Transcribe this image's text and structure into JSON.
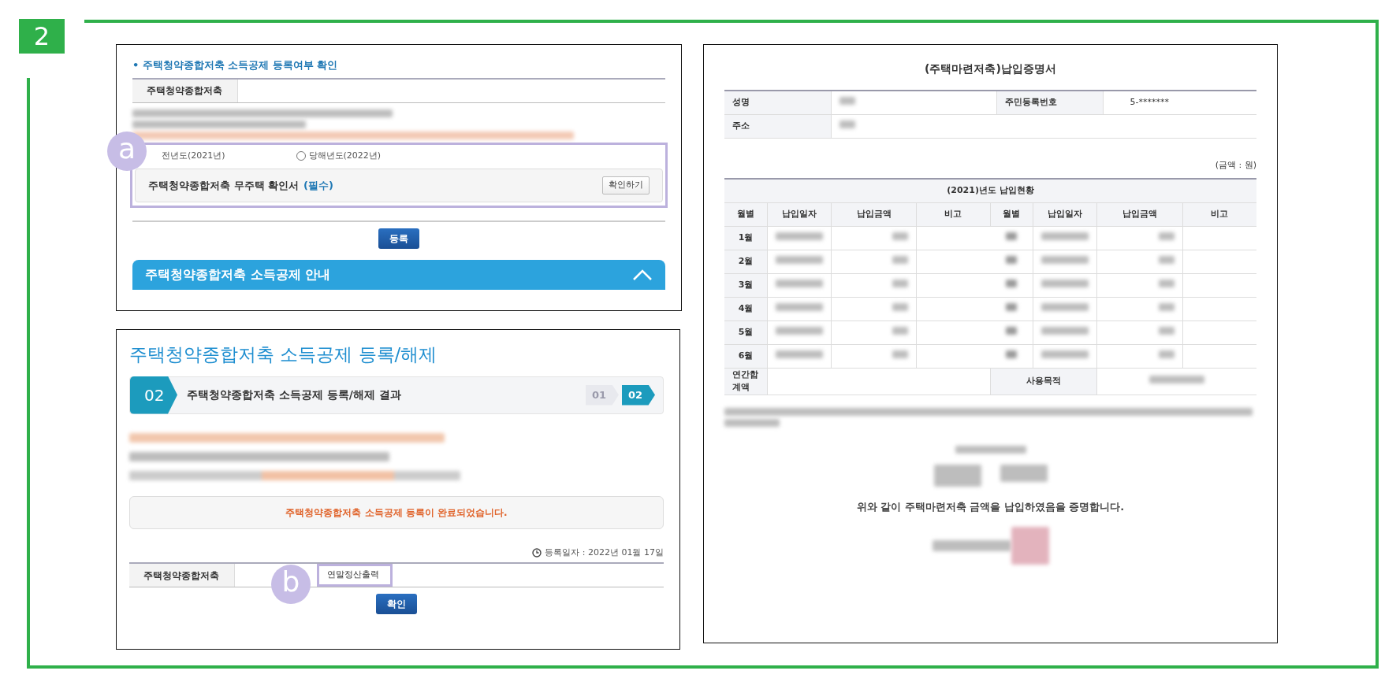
{
  "badge": "2",
  "registration_check": {
    "title": "• 주택청약종합저축 소득공제 등록여부 확인",
    "row_label": "주택청약종합저축",
    "year_options": [
      {
        "label": "전년도(2021년)",
        "kind": "text"
      },
      {
        "label": "당해년도(2022년)",
        "kind": "radio",
        "selected": false
      }
    ],
    "document": {
      "label": "주택청약종합저축 무주택 확인서",
      "required": "(필수)",
      "button": "확인하기"
    },
    "marker": "a",
    "submit": "등록",
    "guide": {
      "title": "주택청약종합저축 소득공제 안내",
      "expanded": true
    }
  },
  "registration_result": {
    "title": "주택청약종합저축 소득공제 등록/해제",
    "step": {
      "number": "02",
      "title": "주택청약종합저축 소득공제 등록/해제 결과"
    },
    "steps": [
      {
        "label": "01",
        "selected": false
      },
      {
        "label": "02",
        "selected": true
      }
    ],
    "message": "주택청약종합저축 소득공제 등록이 완료되었습니다.",
    "date": "등록일자 : 2022년 01월 17일",
    "row_label": "주택청약종합저축",
    "print_button": "연말정산출력",
    "marker": "b",
    "confirm": "확인"
  },
  "certificate": {
    "title": "(주택마련저축)납입증명서",
    "info_rows": [
      [
        {
          "label": "성명"
        },
        {
          "label": "주민등록번호",
          "value": "5-*******"
        }
      ],
      [
        {
          "label": "주소"
        }
      ]
    ],
    "unit": "(금액 : 원)",
    "caption": "(2021)년도 납입현황",
    "columns": [
      "월별",
      "납입일자",
      "납입금액",
      "비고",
      "월별",
      "납입일자",
      "납입금액",
      "비고"
    ],
    "rows": [
      {
        "month": "1월"
      },
      {
        "month": "2월"
      },
      {
        "month": "3월"
      },
      {
        "month": "4월"
      },
      {
        "month": "5월"
      },
      {
        "month": "6월"
      }
    ],
    "total_label": "연간합계액",
    "purpose_label": "사용목적",
    "statement": "위와 같이 주택마련저축 금액을 납입하였음을 증명합니다."
  }
}
